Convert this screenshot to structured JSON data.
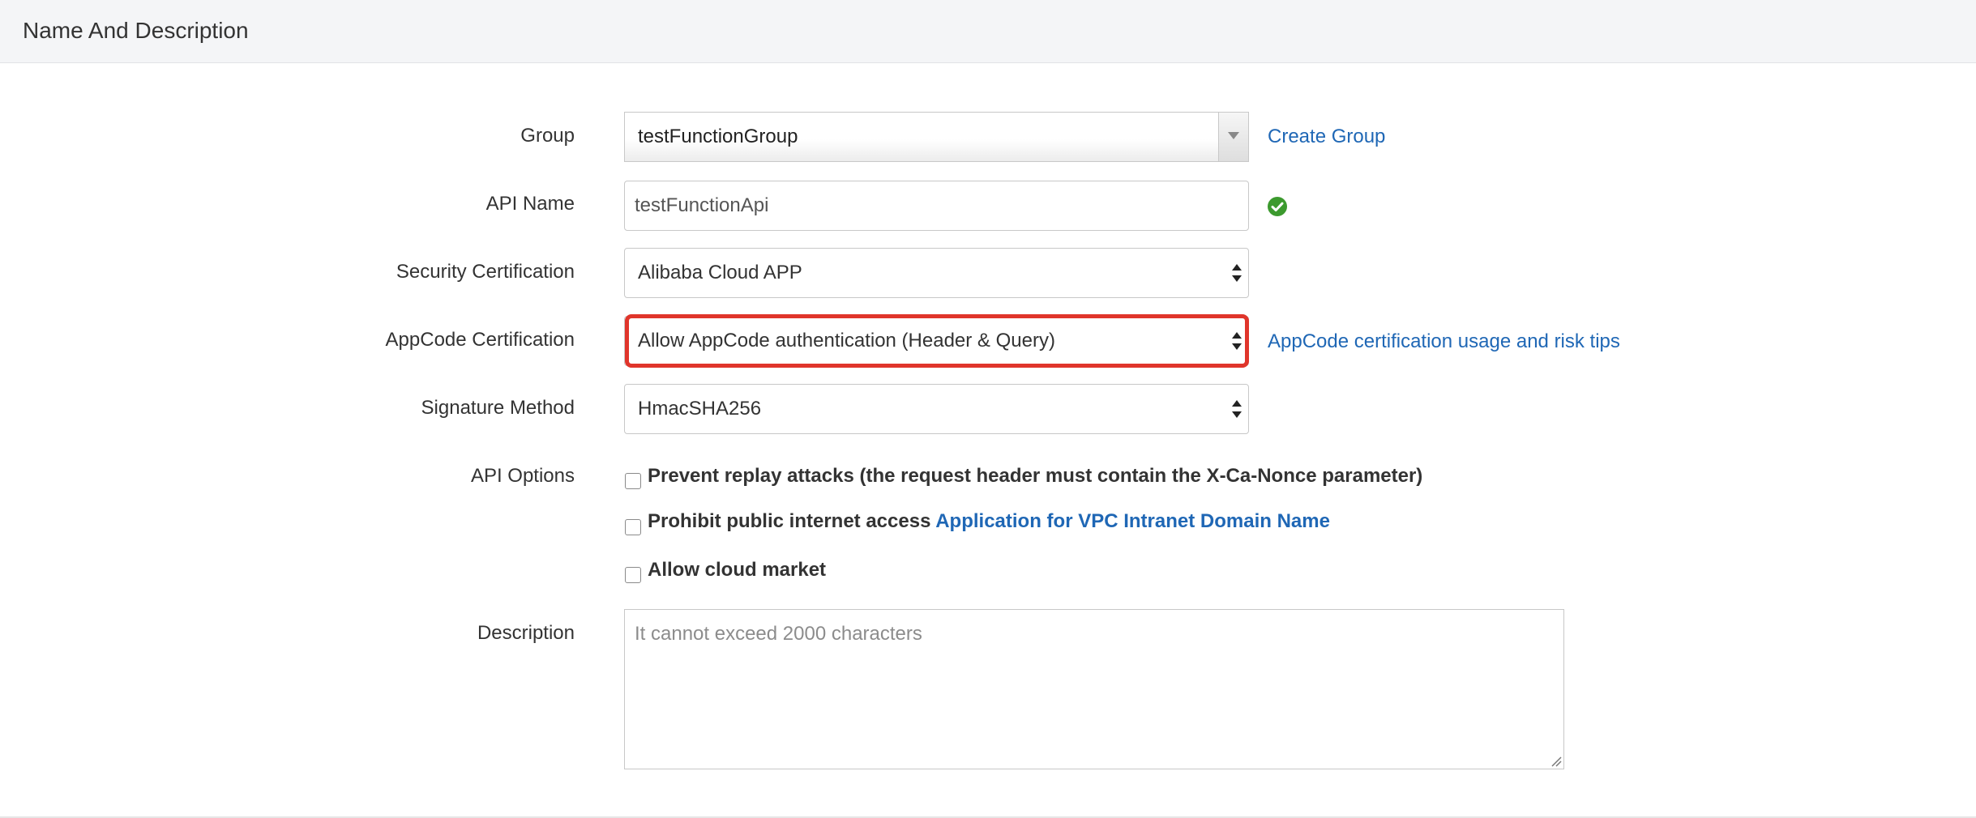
{
  "header": {
    "title": "Name And Description"
  },
  "form": {
    "group": {
      "label": "Group",
      "value": "testFunctionGroup",
      "link": "Create Group"
    },
    "api_name": {
      "label": "API Name",
      "value": "testFunctionApi",
      "status_icon": "check-circle-icon",
      "status_color": "#3c9a2e"
    },
    "security_certification": {
      "label": "Security Certification",
      "value": "Alibaba Cloud APP"
    },
    "appcode_certification": {
      "label": "AppCode Certification",
      "value": "Allow AppCode authentication (Header & Query)",
      "link": "AppCode certification usage and risk tips",
      "highlight_color": "#e0352b"
    },
    "signature_method": {
      "label": "Signature Method",
      "value": "HmacSHA256"
    },
    "api_options": {
      "label": "API Options",
      "options": [
        {
          "label": "Prevent replay attacks (the request header must contain the X-Ca-Nonce parameter)",
          "checked": false
        },
        {
          "label": "Prohibit public internet access",
          "link": "Application for VPC Intranet Domain Name",
          "checked": false
        },
        {
          "label": "Allow cloud market",
          "checked": false
        }
      ]
    },
    "description": {
      "label": "Description",
      "placeholder": "It cannot exceed 2000 characters"
    }
  },
  "colors": {
    "link": "#1f67b5",
    "header_bg": "#f4f5f7"
  }
}
